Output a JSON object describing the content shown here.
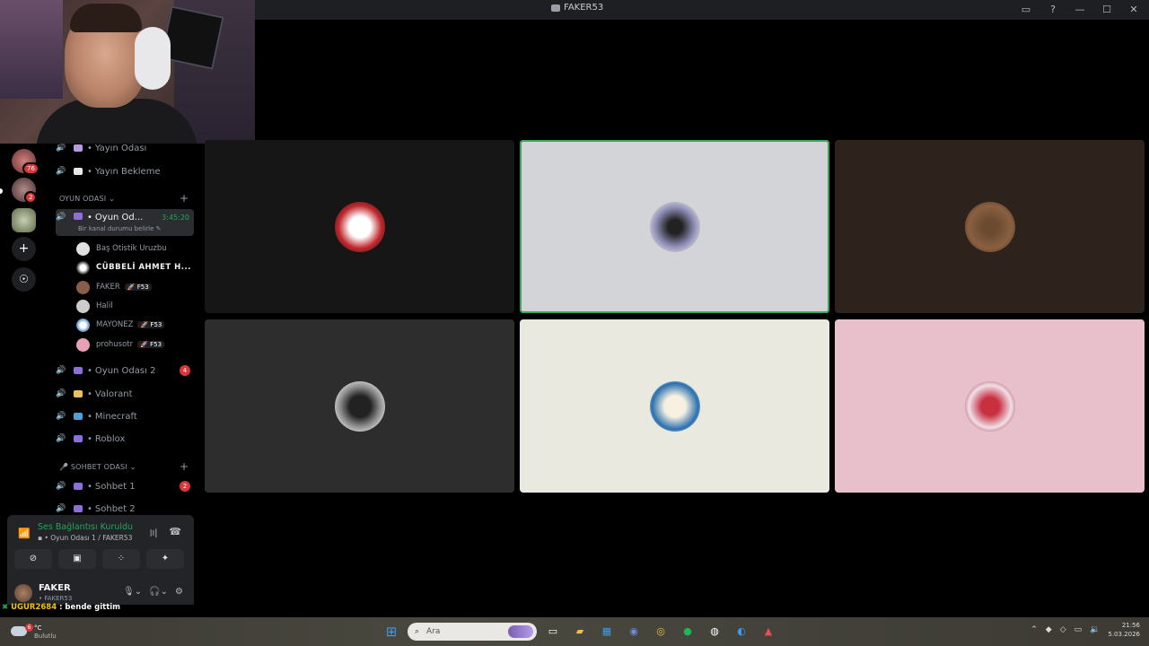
{
  "window": {
    "title": "FAKER53",
    "controls": [
      "inbox-icon",
      "help-icon",
      "minimize-icon",
      "maximize-icon",
      "close-icon"
    ]
  },
  "servers": [
    {
      "name": "server-1",
      "badge": "76",
      "color": "#a05050"
    },
    {
      "name": "server-2",
      "badge": "2",
      "color": "#8c6e6e"
    },
    {
      "name": "server-3",
      "badge": "",
      "color": "#7a8a6a"
    }
  ],
  "rail_actions": {
    "add": "+",
    "discover": "☉"
  },
  "channels": {
    "top": [
      {
        "name": "Yayın Odası",
        "icon_color": "#b89ae0"
      },
      {
        "name": "Yayın Bekleme",
        "icon_color": "#e8e8e8"
      }
    ],
    "category_game": "OYUN ODASI",
    "active": {
      "name": "Oyun Od...",
      "timer": "3:45:20",
      "status_hint": "Bir kanal durumu belirle"
    },
    "members": [
      {
        "name": "Baş Otistik Uruzbu",
        "tag": "",
        "bold": false,
        "color": "#e0e0e0"
      },
      {
        "name": "CÜBBELİ AHMET H...",
        "tag": "",
        "bold": true,
        "color": "#ffffff"
      },
      {
        "name": "FAKER",
        "tag": "F53",
        "bold": false,
        "color": "#8a5d48"
      },
      {
        "name": "Halil",
        "tag": "",
        "bold": false,
        "color": "#cccccc"
      },
      {
        "name": "MAYONEZ",
        "tag": "F53",
        "bold": false,
        "color": "#e8e4d8"
      },
      {
        "name": "prohusotr",
        "tag": "F53",
        "bold": false,
        "color": "#e8a0b8"
      }
    ],
    "others": [
      {
        "name": "Oyun Odası 2",
        "badge": "4",
        "icon_color": "#8c6fd8"
      },
      {
        "name": "Valorant",
        "badge": "",
        "icon_color": "#e8c060"
      },
      {
        "name": "Minecraft",
        "badge": "",
        "icon_color": "#50a0d8"
      },
      {
        "name": "Roblox",
        "badge": "",
        "icon_color": "#8c6fd8"
      }
    ],
    "category_chat": "SOHBET ODASI",
    "chat": [
      {
        "name": "Sohbet 1",
        "badge": "2"
      },
      {
        "name": "Sohbet 2",
        "badge": ""
      }
    ]
  },
  "voice": {
    "status": "Ses Bağlantısı Kuruldu",
    "location": "Oyun Odası 1 / FAKER53",
    "user": {
      "name": "FAKER",
      "status": "FAKER53"
    }
  },
  "chat_overlay": {
    "user": "UGUR2684",
    "message": ": bende gittim"
  },
  "tiles": [
    {
      "bg": "#161616",
      "avatar": "anime-avatar",
      "speaking": false,
      "pic": "radial-gradient(circle,#fff 30%,#c0282d 60%,#111 100%)"
    },
    {
      "bg": "#d3d4d8",
      "avatar": "winged-avatar",
      "speaking": true,
      "pic": "radial-gradient(circle,#222 20%,#8f8fb8 55%,#d3d4d8 80%)"
    },
    {
      "bg": "#2e231c",
      "avatar": "person-avatar",
      "speaking": false,
      "pic": "radial-gradient(circle,#6b4a30 20%,#8a6040 60%,#3a2a20 100%)"
    },
    {
      "bg": "#2d2d2d",
      "avatar": "suit-avatar",
      "speaking": false,
      "pic": "radial-gradient(circle,#222 30%,#888 55%,#ddd 80%)"
    },
    {
      "bg": "#e9e9df",
      "avatar": "mayonnaise-avatar",
      "speaking": false,
      "pic": "radial-gradient(circle,#f5f0e0 30%,#2a6fb0 65%,#e9e9df 85%)"
    },
    {
      "bg": "#e8c0cc",
      "avatar": "violin-avatar",
      "speaking": false,
      "pic": "radial-gradient(circle,#c83040 25%,#f0e0e8 60%,#b04050 85%)"
    }
  ],
  "taskbar": {
    "weather": {
      "badge": "6",
      "temp": "°C",
      "desc": "Bulutlu"
    },
    "search_placeholder": "Ara",
    "clock": {
      "time": "21:56",
      "date": "5.03.2026"
    }
  }
}
